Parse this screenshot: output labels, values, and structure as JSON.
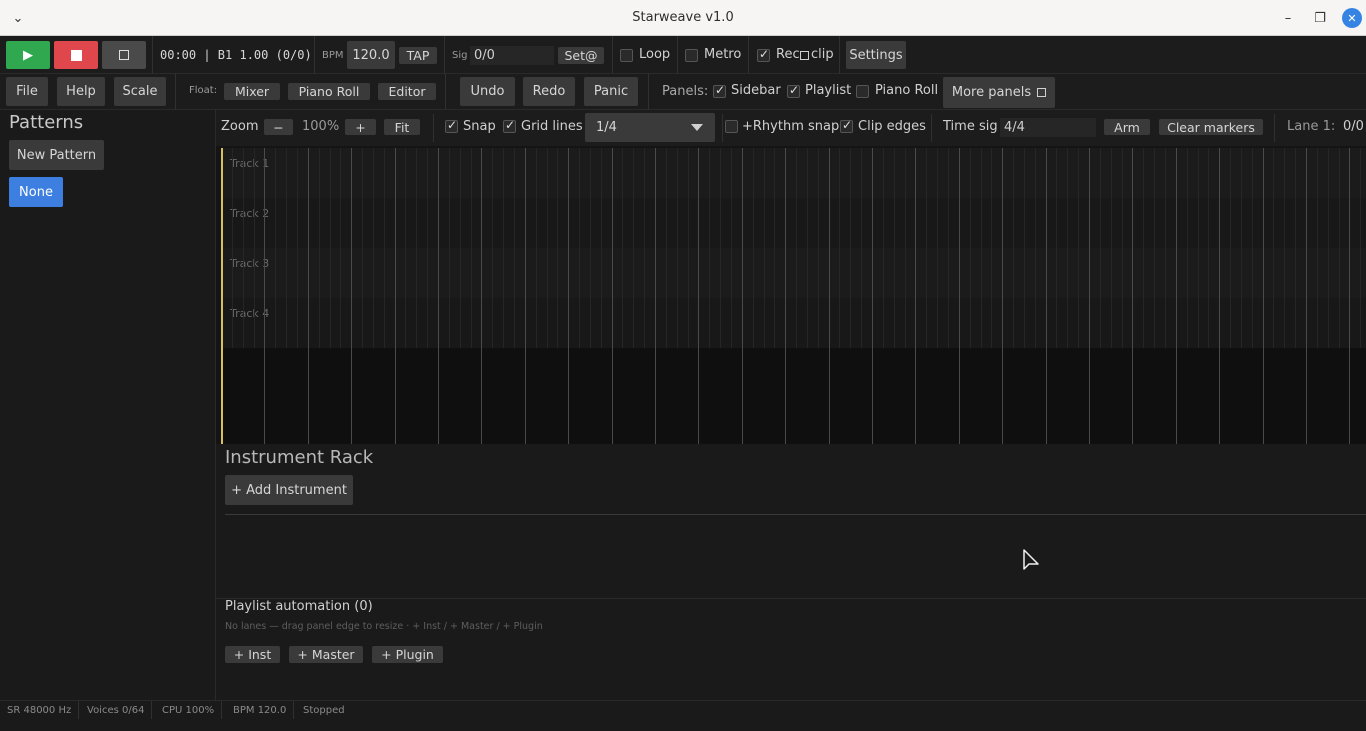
{
  "window": {
    "title": "Starweave v1.0"
  },
  "transport": {
    "time_display": "00:00 | B1 1.00 (0/0)",
    "bpm_label": "BPM",
    "bpm_value": "120.0",
    "tap_label": "TAP",
    "sig_label": "Sig",
    "sig_value": "0/0",
    "set_label": "Set@",
    "loop_label": "Loop",
    "metro_label": "Metro",
    "rec_label": "Rec",
    "clip_label": "clip",
    "settings_label": "Settings",
    "loop_checked": false,
    "metro_checked": false,
    "rec_checked": true
  },
  "menu": {
    "file": "File",
    "help": "Help",
    "scale": "Scale",
    "float_label": "Float:",
    "mixer": "Mixer",
    "piano_roll": "Piano Roll",
    "editor": "Editor",
    "undo": "Undo",
    "redo": "Redo",
    "panic": "Panic",
    "panels_label": "Panels:",
    "panel_sidebar": "Sidebar",
    "panel_playlist": "Playlist",
    "panel_pianoroll": "Piano Roll",
    "more_panels": "More panels",
    "sidebar_checked": true,
    "playlist_checked": true,
    "pianoroll_checked": false
  },
  "sidebar": {
    "title": "Patterns",
    "new_pattern": "New Pattern",
    "selected_pattern": "None"
  },
  "playlist_toolbar": {
    "zoom_label": "Zoom",
    "zoom_minus": "−",
    "zoom_value": "100%",
    "zoom_plus": "+",
    "fit": "Fit",
    "snap": "Snap",
    "grid_lines": "Grid lines",
    "grid_value": "1/4",
    "rhythm_snap": "+Rhythm snap",
    "clip_edges": "Clip edges",
    "time_sig_label": "Time sig",
    "time_sig_value": "4/4",
    "arm": "Arm",
    "clear_markers": "Clear markers",
    "lane_label": "Lane 1:",
    "lane_value": "0/0"
  },
  "tracks": [
    "Track 1",
    "Track 2",
    "Track 3",
    "Track 4"
  ],
  "instrument_rack": {
    "title": "Instrument Rack",
    "add_instrument": "+ Add Instrument"
  },
  "automation": {
    "title": "Playlist automation (0)",
    "hint": "No lanes — drag panel edge to resize · + Inst / + Master / + Plugin",
    "add_inst": "+ Inst",
    "add_master": "+ Master",
    "add_plugin": "+ Plugin"
  },
  "statusbar": {
    "sample_rate": "SR 48000 Hz",
    "voices": "Voices 0/64",
    "cpu": "CPU 100%",
    "bpm": "BPM 120.0",
    "state": "Stopped"
  },
  "colors": {
    "play": "#2fa84f",
    "stop": "#e0474c",
    "accent": "#3d7fe0",
    "playhead": "#d8c060"
  }
}
